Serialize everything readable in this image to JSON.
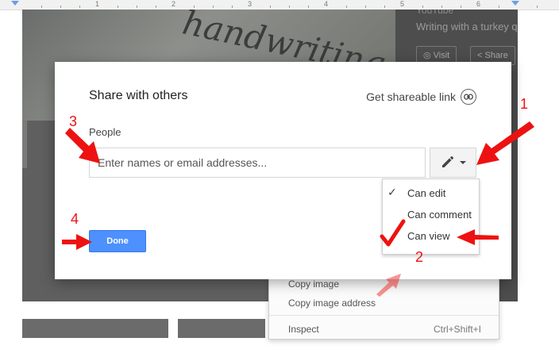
{
  "ruler": {
    "numbers": [
      "1",
      "2",
      "3",
      "4",
      "5",
      "6"
    ]
  },
  "background": {
    "video_channel": "YouTube",
    "video_title": "Writing with a turkey q",
    "visit_label": "Visit",
    "share_label": "Share"
  },
  "context_menu": {
    "items": [
      {
        "label": "Copy image",
        "shortcut": ""
      },
      {
        "label": "Copy image address",
        "shortcut": ""
      },
      {
        "label": "Inspect",
        "shortcut": "Ctrl+Shift+I"
      }
    ]
  },
  "dialog": {
    "title": "Share with others",
    "shareable_link_label": "Get shareable link",
    "people_label": "People",
    "email_input_value": "",
    "email_input_placeholder": "Enter names or email addresses...",
    "done_label": "Done",
    "permission_options": [
      {
        "label": "Can edit",
        "checked": true
      },
      {
        "label": "Can comment",
        "checked": false
      },
      {
        "label": "Can view",
        "checked": false
      }
    ]
  },
  "annotations": {
    "n1": "1",
    "n2": "2",
    "n3": "3",
    "n4": "4",
    "color": "#ee1111"
  },
  "colors": {
    "done_button": "#4d90fe",
    "ruler_marker": "#6e9de4"
  },
  "icons": {
    "shareable_link": "link-icon",
    "permission": "pencil-icon",
    "dropdown": "caret-down-icon",
    "checked": "checkmark-icon"
  }
}
